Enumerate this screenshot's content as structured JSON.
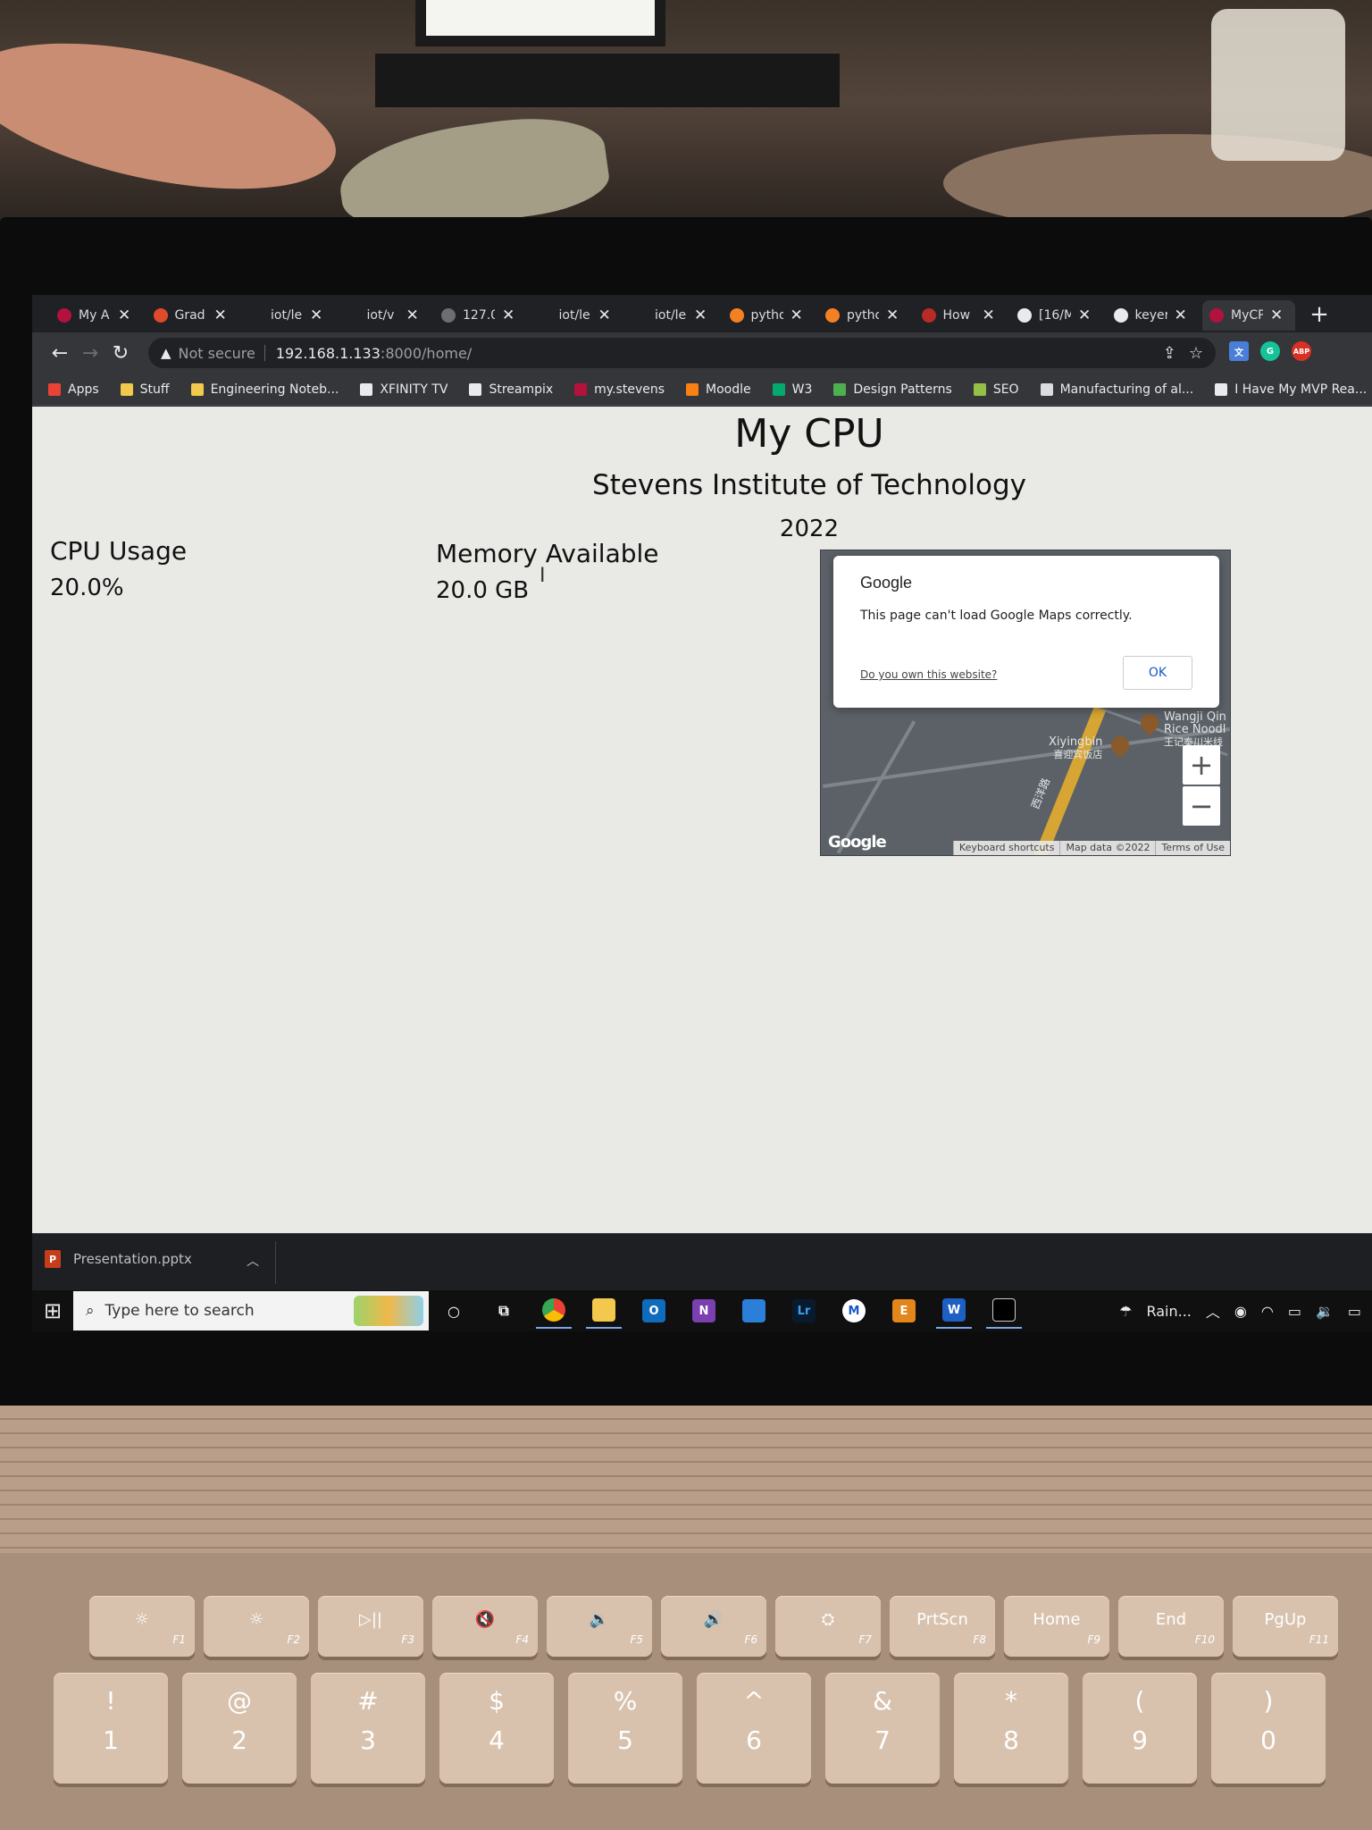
{
  "browser": {
    "tabs": [
      {
        "label": "My A",
        "fav": "#b3123c"
      },
      {
        "label": "Grad",
        "fav": "#e04a2a"
      },
      {
        "label": "iot/le",
        "fav": "#202124"
      },
      {
        "label": "iot/v",
        "fav": "#202124"
      },
      {
        "label": "127.0",
        "fav": "#6b6e73"
      },
      {
        "label": "iot/le",
        "fav": "#202124"
      },
      {
        "label": "iot/le",
        "fav": "#202124"
      },
      {
        "label": "pytho",
        "fav": "#f48024"
      },
      {
        "label": "pytho",
        "fav": "#f48024"
      },
      {
        "label": "How",
        "fav": "#b92b27"
      },
      {
        "label": "[16/M",
        "fav": "#e8eaed"
      },
      {
        "label": "keyer",
        "fav": "#e8eaed"
      },
      {
        "label": "MyCP",
        "fav": "#b3123c"
      }
    ],
    "address": {
      "warning": "Not secure",
      "host": "192.168.1.133",
      "path": ":8000/home/"
    },
    "extensions": [
      "G",
      "ABP"
    ],
    "bookmarks": [
      {
        "label": "Apps",
        "icon": "apps-grid-icon"
      },
      {
        "label": "Stuff",
        "icon": "folder-icon"
      },
      {
        "label": "Engineering Noteb...",
        "icon": "folder-icon"
      },
      {
        "label": "XFINITY TV",
        "icon": "x-logo-icon"
      },
      {
        "label": "Streampix",
        "icon": "x-logo-icon"
      },
      {
        "label": "my.stevens",
        "icon": "stevens-icon"
      },
      {
        "label": "Moodle",
        "icon": "moodle-icon"
      },
      {
        "label": "W3",
        "icon": "w3-icon"
      },
      {
        "label": "Design Patterns",
        "icon": "leaf-icon"
      },
      {
        "label": "SEO",
        "icon": "shopify-icon"
      },
      {
        "label": "Manufacturing of al...",
        "icon": "page-icon"
      },
      {
        "label": "I Have My MVP Rea...",
        "icon": "medium-icon"
      }
    ]
  },
  "page": {
    "title": "My CPU",
    "subtitle": "Stevens Institute of Technology",
    "year": "2022",
    "cpu": {
      "label": "CPU Usage",
      "value": "20.0%"
    },
    "memory": {
      "label": "Memory Available",
      "value": "20.0 GB"
    },
    "map": {
      "dialog_title": "Google",
      "dialog_message": "This page can't load Google Maps correctly.",
      "dialog_link": "Do you own this website?",
      "dialog_ok": "OK",
      "poi_1": "Wangji Qin Rice Noodl",
      "poi_1_cjk": "王记秦川米线",
      "poi_2": "Xiyingbin",
      "poi_2_cjk": "喜迎宾饭店",
      "road_label": "西洋路",
      "logo": "Google",
      "attribution": [
        "Keyboard shortcuts",
        "Map data ©2022",
        "Terms of Use"
      ]
    }
  },
  "download": {
    "file": "Presentation.pptx"
  },
  "taskbar": {
    "search_placeholder": "Type here to search",
    "weather": "Rain...",
    "apps": [
      "Chrome",
      "File Explorer",
      "Outlook",
      "OneNote",
      "Store",
      "Lightroom",
      "App",
      "Elementor",
      "Word",
      "Terminal"
    ]
  },
  "keyboard": {
    "fn_row": [
      {
        "top": "☼",
        "fn": "F1"
      },
      {
        "top": "☼",
        "fn": "F2"
      },
      {
        "top": "▷||",
        "fn": "F3"
      },
      {
        "top": "🔇",
        "fn": "F4"
      },
      {
        "top": "🔉",
        "fn": "F5"
      },
      {
        "top": "🔊",
        "fn": "F6"
      },
      {
        "top": "⛭",
        "fn": "F7"
      },
      {
        "top": "PrtScn",
        "fn": "F8"
      },
      {
        "top": "Home",
        "fn": "F9"
      },
      {
        "top": "End",
        "fn": "F10"
      },
      {
        "top": "PgUp",
        "fn": "F11"
      }
    ],
    "num_row": [
      {
        "shift": "!",
        "key": "1"
      },
      {
        "shift": "@",
        "key": "2"
      },
      {
        "shift": "#",
        "key": "3"
      },
      {
        "shift": "$",
        "key": "4"
      },
      {
        "shift": "%",
        "key": "5"
      },
      {
        "shift": "^",
        "key": "6"
      },
      {
        "shift": "&",
        "key": "7"
      },
      {
        "shift": "*",
        "key": "8"
      },
      {
        "shift": "(",
        "key": "9"
      },
      {
        "shift": ")",
        "key": "0"
      }
    ]
  }
}
